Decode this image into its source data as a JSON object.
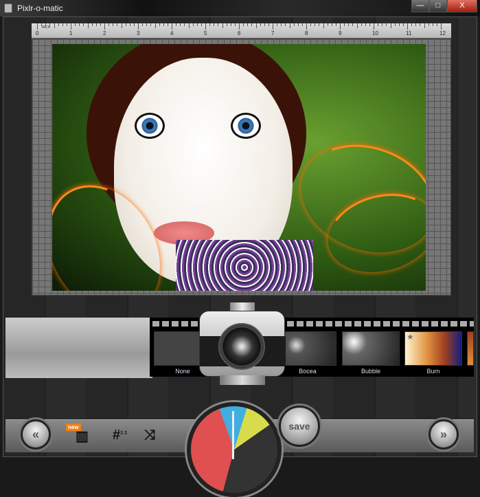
{
  "window": {
    "title": "Pixlr-o-matic",
    "minimize": "—",
    "maximize": "□",
    "close": "X"
  },
  "ruler": {
    "unit": "INCH",
    "labels": [
      "0",
      "1",
      "2",
      "3",
      "4",
      "5",
      "6",
      "7",
      "8",
      "9",
      "10",
      "11",
      "12"
    ]
  },
  "filters": [
    {
      "label": "None"
    },
    {
      "label": "Bocea"
    },
    {
      "label": "Bubble"
    },
    {
      "label": "Burn"
    }
  ],
  "toolbar": {
    "prev": "«",
    "next": "»",
    "save": "save",
    "new_badge": "new",
    "film_icon": "film-plus-icon",
    "crop_icon": "crop-1-1-icon",
    "shuffle_icon": "shuffle-icon",
    "crop_label": "1:1"
  }
}
